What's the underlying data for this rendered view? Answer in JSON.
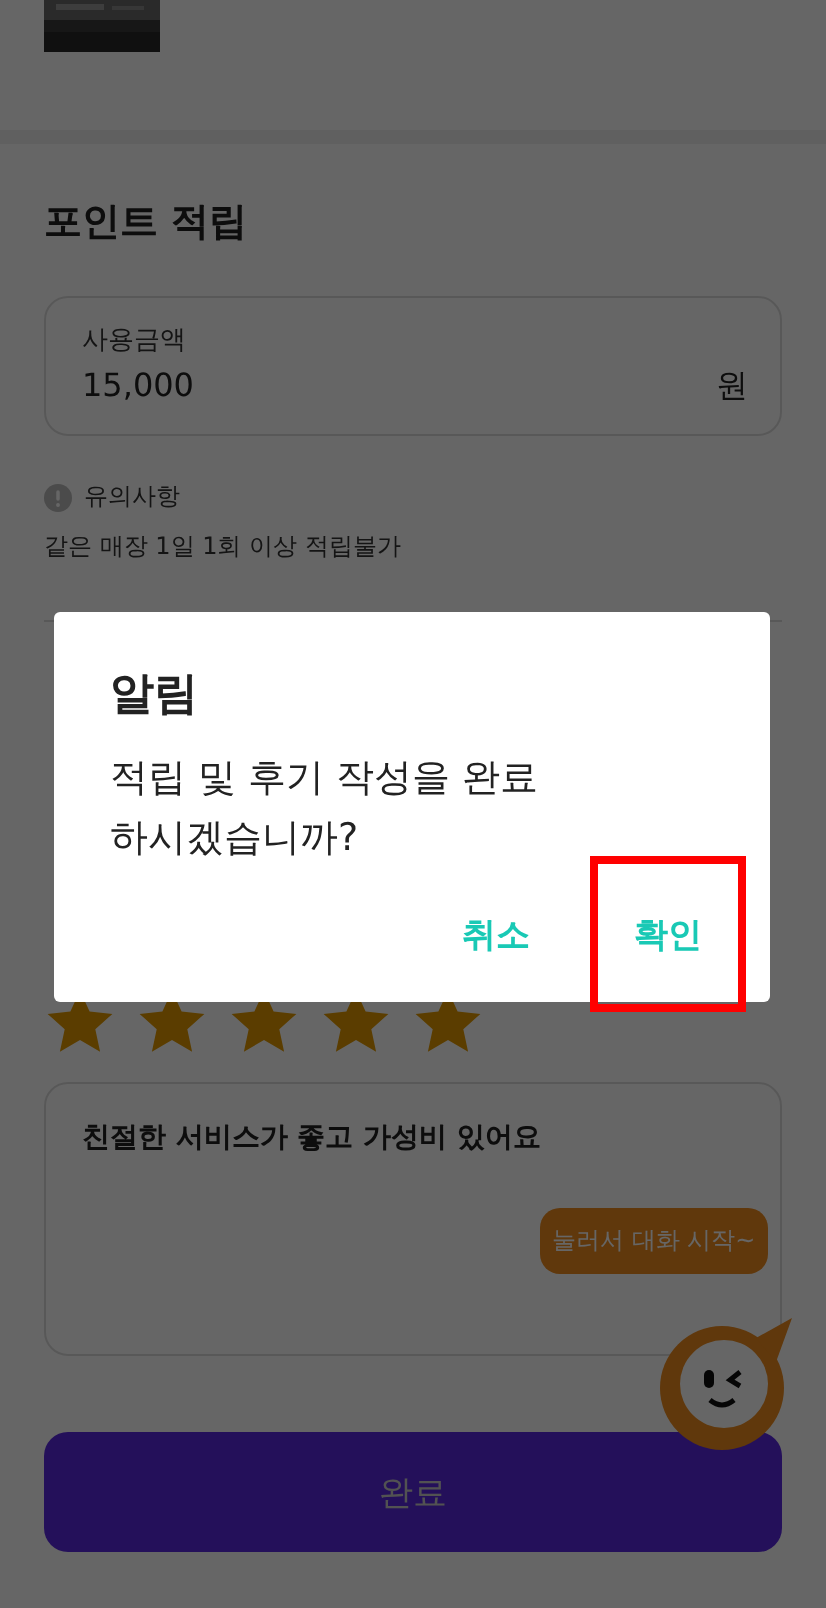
{
  "points": {
    "title": "포인트 적립",
    "amount": {
      "label": "사용금액",
      "value": "15,000",
      "unit": "원"
    },
    "notice": {
      "title": "유의사항",
      "text": "같은 매장 1일 1회 이상 적립불가"
    }
  },
  "review": {
    "stars": 5,
    "comment": "친절한 서비스가 좋고 가성비  있어요"
  },
  "chat": {
    "tooltip": "눌러서 대화 시작~"
  },
  "submit": "완료",
  "dialog": {
    "title": "알림",
    "message": "적립 및 후기 작성을 완료\n하시겠습니까?",
    "buttons": [
      {
        "label": "취소",
        "highlighted": false
      },
      {
        "label": "확인",
        "highlighted": true
      }
    ]
  }
}
